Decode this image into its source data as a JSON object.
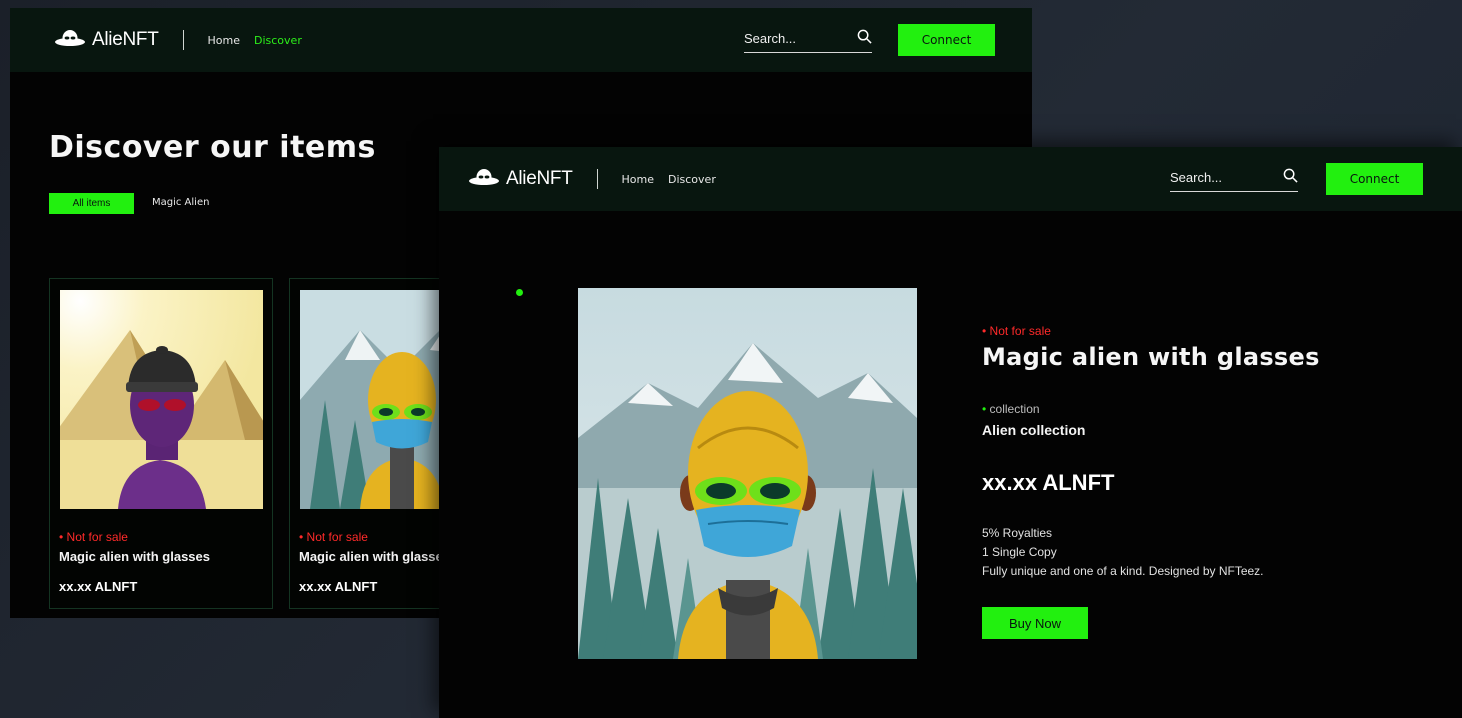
{
  "back_window": {
    "logo_text": "AlieNFT",
    "nav": [
      {
        "label": "Home"
      },
      {
        "label": "Discover"
      }
    ],
    "search_placeholder": "Search...",
    "connect_label": "Connect",
    "title": "Discover our items",
    "filters": [
      {
        "label": "All items"
      },
      {
        "label": "Magic Alien"
      }
    ],
    "cards": [
      {
        "status": "Not for sale",
        "name": "Magic alien with glasses",
        "price": "xx.xx ALNFT"
      },
      {
        "status": "Not for sale",
        "name": "Magic alien with glasses",
        "price": "xx.xx ALNFT"
      }
    ]
  },
  "front_window": {
    "logo_text": "AlieNFT",
    "nav": [
      {
        "label": "Home"
      },
      {
        "label": "Discover"
      }
    ],
    "search_placeholder": "Search...",
    "connect_label": "Connect",
    "detail": {
      "status": "Not for sale",
      "name": "Magic alien with glasses",
      "collection_label": "collection",
      "collection": "Alien collection",
      "price": "xx.xx ALNFT",
      "royalties": "5% Royalties",
      "copies": "1 Single Copy",
      "description": "Fully unique and one of a kind. Designed by NFTeez.",
      "buy_label": "Buy Now"
    }
  },
  "colors": {
    "accent": "#22f00f",
    "status": "#ff2a2a",
    "nav_bg": "#08160f",
    "page_bg": "#030303"
  }
}
